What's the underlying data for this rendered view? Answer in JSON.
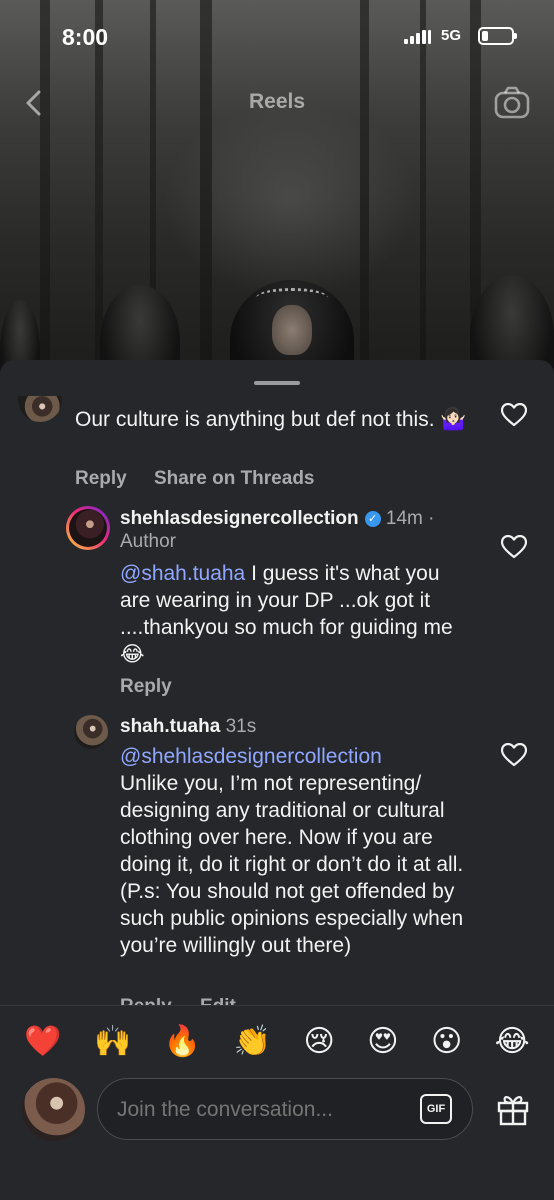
{
  "status_bar": {
    "time": "8:00",
    "network": "5G"
  },
  "header": {
    "title": "Reels"
  },
  "comments": [
    {
      "text": "Our culture is anything but def not this. 🤷🏻‍♀️",
      "actions": {
        "reply": "Reply",
        "share": "Share on Threads"
      }
    },
    {
      "username": "shehlasdesignercollection",
      "time": "14m",
      "separator": "·",
      "badge": "Author",
      "mention": "@shah.tuaha",
      "text": " I guess it's what you are wearing in your DP ...ok got it ....thankyou so much for guiding me 😂",
      "actions": {
        "reply": "Reply"
      }
    },
    {
      "username": "shah.tuaha",
      "time": "31s",
      "mention": "@shehlasdesignercollection",
      "text": "Unlike you, I’m not representing/ designing any traditional or cultural clothing over here. Now if you are doing it, do it right or don’t do it at all. (P.s: You should not get offended by such public opinions especially when you’re willingly out there)",
      "actions": {
        "reply": "Reply",
        "edit": "Edit"
      }
    }
  ],
  "emoji_bar": [
    "❤️",
    "🙌",
    "🔥",
    "👏",
    "😢",
    "😍",
    "😮",
    "😂"
  ],
  "composer": {
    "placeholder": "Join the conversation...",
    "gif_label": "GIF"
  }
}
